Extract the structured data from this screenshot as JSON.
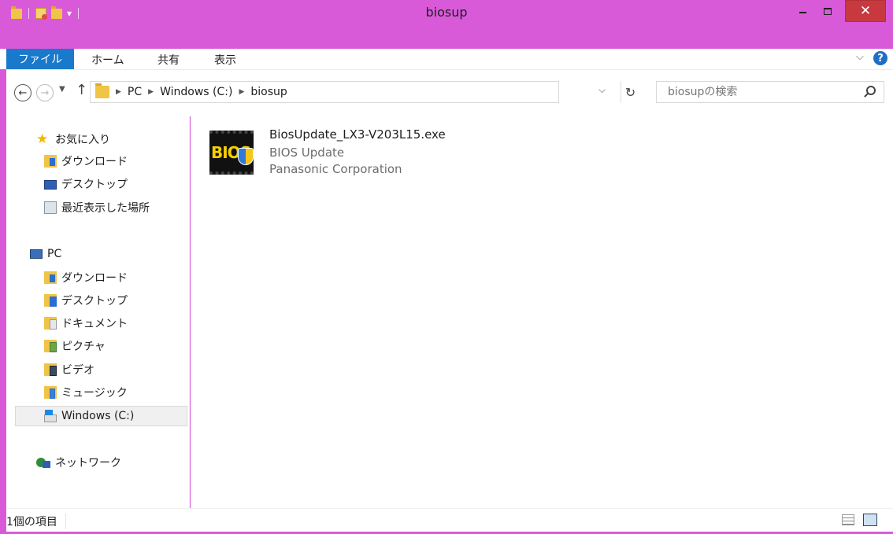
{
  "window": {
    "title": "biosup",
    "close_glyph": "✕",
    "accent": "#d95ad9"
  },
  "ribbon": {
    "file_tab": "ファイル",
    "home_tab": "ホーム",
    "share_tab": "共有",
    "view_tab": "表示",
    "help_glyph": "?"
  },
  "navigation": {
    "breadcrumb": [
      "PC",
      "Windows (C:)",
      "biosup"
    ],
    "search_placeholder": "biosupの検索"
  },
  "sidebar": {
    "favorites": {
      "label": "お気に入り",
      "items": [
        "ダウンロード",
        "デスクトップ",
        "最近表示した場所"
      ]
    },
    "pc": {
      "label": "PC",
      "items": [
        "ダウンロード",
        "デスクトップ",
        "ドキュメント",
        "ピクチャ",
        "ビデオ",
        "ミュージック",
        "Windows (C:)"
      ]
    },
    "network": {
      "label": "ネットワーク"
    },
    "selected": "Windows (C:)"
  },
  "files": [
    {
      "name": "BiosUpdate_LX3-V203L15.exe",
      "description": "BIOS Update",
      "company": "Panasonic Corporation",
      "icon": "bios-icon",
      "icon_text": "BIOS"
    }
  ],
  "status": {
    "item_count": "1個の項目"
  }
}
